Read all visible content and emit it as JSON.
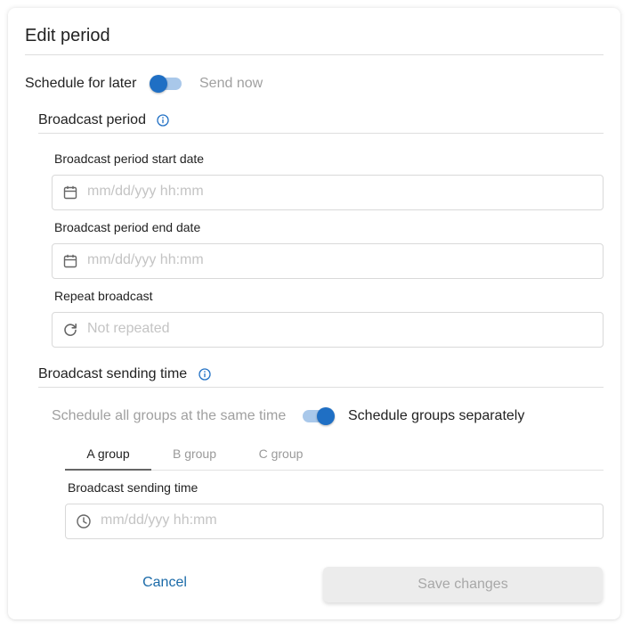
{
  "dialog": {
    "title": "Edit period"
  },
  "send_mode": {
    "left_label": "Schedule for later",
    "right_label": "Send now"
  },
  "broadcast_period": {
    "title": "Broadcast period",
    "start_label": "Broadcast period start date",
    "start_placeholder": "mm/dd/yyy hh:mm",
    "end_label": "Broadcast period end date",
    "end_placeholder": "mm/dd/yyy hh:mm",
    "repeat_label": "Repeat broadcast",
    "repeat_placeholder": "Not repeated"
  },
  "sending_time": {
    "title": "Broadcast sending time",
    "left_label": "Schedule all groups at the same time",
    "right_label": "Schedule groups separately",
    "tabs": [
      {
        "label": "A group"
      },
      {
        "label": "B group"
      },
      {
        "label": "C group"
      }
    ],
    "time_label": "Broadcast sending time",
    "time_placeholder": "mm/dd/yyy hh:mm"
  },
  "actions": {
    "cancel": "Cancel",
    "save": "Save changes"
  },
  "colors": {
    "accent": "#1f6fc4",
    "toggle_track": "#a9c8ea",
    "link": "#1a6aa8",
    "disabled_button_bg": "#ececec",
    "disabled_button_text": "#a8a8a8"
  },
  "icons": {
    "info": "info-circle-icon",
    "calendar": "calendar-icon",
    "repeat": "refresh-icon",
    "clock": "clock-icon"
  }
}
